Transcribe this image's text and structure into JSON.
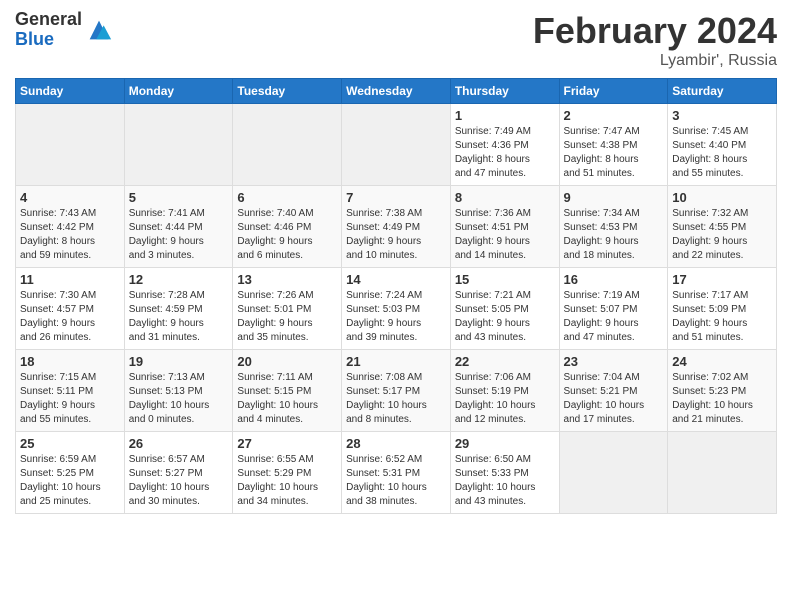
{
  "logo": {
    "general": "General",
    "blue": "Blue"
  },
  "title": {
    "month_year": "February 2024",
    "location": "Lyambir', Russia"
  },
  "days_of_week": [
    "Sunday",
    "Monday",
    "Tuesday",
    "Wednesday",
    "Thursday",
    "Friday",
    "Saturday"
  ],
  "weeks": [
    [
      {
        "num": "",
        "info": ""
      },
      {
        "num": "",
        "info": ""
      },
      {
        "num": "",
        "info": ""
      },
      {
        "num": "",
        "info": ""
      },
      {
        "num": "1",
        "info": "Sunrise: 7:49 AM\nSunset: 4:36 PM\nDaylight: 8 hours\nand 47 minutes."
      },
      {
        "num": "2",
        "info": "Sunrise: 7:47 AM\nSunset: 4:38 PM\nDaylight: 8 hours\nand 51 minutes."
      },
      {
        "num": "3",
        "info": "Sunrise: 7:45 AM\nSunset: 4:40 PM\nDaylight: 8 hours\nand 55 minutes."
      }
    ],
    [
      {
        "num": "4",
        "info": "Sunrise: 7:43 AM\nSunset: 4:42 PM\nDaylight: 8 hours\nand 59 minutes."
      },
      {
        "num": "5",
        "info": "Sunrise: 7:41 AM\nSunset: 4:44 PM\nDaylight: 9 hours\nand 3 minutes."
      },
      {
        "num": "6",
        "info": "Sunrise: 7:40 AM\nSunset: 4:46 PM\nDaylight: 9 hours\nand 6 minutes."
      },
      {
        "num": "7",
        "info": "Sunrise: 7:38 AM\nSunset: 4:49 PM\nDaylight: 9 hours\nand 10 minutes."
      },
      {
        "num": "8",
        "info": "Sunrise: 7:36 AM\nSunset: 4:51 PM\nDaylight: 9 hours\nand 14 minutes."
      },
      {
        "num": "9",
        "info": "Sunrise: 7:34 AM\nSunset: 4:53 PM\nDaylight: 9 hours\nand 18 minutes."
      },
      {
        "num": "10",
        "info": "Sunrise: 7:32 AM\nSunset: 4:55 PM\nDaylight: 9 hours\nand 22 minutes."
      }
    ],
    [
      {
        "num": "11",
        "info": "Sunrise: 7:30 AM\nSunset: 4:57 PM\nDaylight: 9 hours\nand 26 minutes."
      },
      {
        "num": "12",
        "info": "Sunrise: 7:28 AM\nSunset: 4:59 PM\nDaylight: 9 hours\nand 31 minutes."
      },
      {
        "num": "13",
        "info": "Sunrise: 7:26 AM\nSunset: 5:01 PM\nDaylight: 9 hours\nand 35 minutes."
      },
      {
        "num": "14",
        "info": "Sunrise: 7:24 AM\nSunset: 5:03 PM\nDaylight: 9 hours\nand 39 minutes."
      },
      {
        "num": "15",
        "info": "Sunrise: 7:21 AM\nSunset: 5:05 PM\nDaylight: 9 hours\nand 43 minutes."
      },
      {
        "num": "16",
        "info": "Sunrise: 7:19 AM\nSunset: 5:07 PM\nDaylight: 9 hours\nand 47 minutes."
      },
      {
        "num": "17",
        "info": "Sunrise: 7:17 AM\nSunset: 5:09 PM\nDaylight: 9 hours\nand 51 minutes."
      }
    ],
    [
      {
        "num": "18",
        "info": "Sunrise: 7:15 AM\nSunset: 5:11 PM\nDaylight: 9 hours\nand 55 minutes."
      },
      {
        "num": "19",
        "info": "Sunrise: 7:13 AM\nSunset: 5:13 PM\nDaylight: 10 hours\nand 0 minutes."
      },
      {
        "num": "20",
        "info": "Sunrise: 7:11 AM\nSunset: 5:15 PM\nDaylight: 10 hours\nand 4 minutes."
      },
      {
        "num": "21",
        "info": "Sunrise: 7:08 AM\nSunset: 5:17 PM\nDaylight: 10 hours\nand 8 minutes."
      },
      {
        "num": "22",
        "info": "Sunrise: 7:06 AM\nSunset: 5:19 PM\nDaylight: 10 hours\nand 12 minutes."
      },
      {
        "num": "23",
        "info": "Sunrise: 7:04 AM\nSunset: 5:21 PM\nDaylight: 10 hours\nand 17 minutes."
      },
      {
        "num": "24",
        "info": "Sunrise: 7:02 AM\nSunset: 5:23 PM\nDaylight: 10 hours\nand 21 minutes."
      }
    ],
    [
      {
        "num": "25",
        "info": "Sunrise: 6:59 AM\nSunset: 5:25 PM\nDaylight: 10 hours\nand 25 minutes."
      },
      {
        "num": "26",
        "info": "Sunrise: 6:57 AM\nSunset: 5:27 PM\nDaylight: 10 hours\nand 30 minutes."
      },
      {
        "num": "27",
        "info": "Sunrise: 6:55 AM\nSunset: 5:29 PM\nDaylight: 10 hours\nand 34 minutes."
      },
      {
        "num": "28",
        "info": "Sunrise: 6:52 AM\nSunset: 5:31 PM\nDaylight: 10 hours\nand 38 minutes."
      },
      {
        "num": "29",
        "info": "Sunrise: 6:50 AM\nSunset: 5:33 PM\nDaylight: 10 hours\nand 43 minutes."
      },
      {
        "num": "",
        "info": ""
      },
      {
        "num": "",
        "info": ""
      }
    ]
  ]
}
